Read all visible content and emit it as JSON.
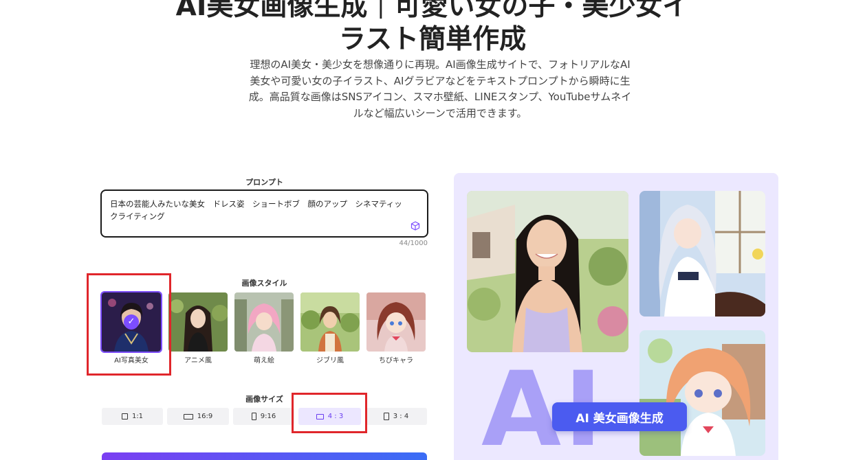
{
  "header": {
    "title_line1": "AI美女画像生成｜可愛い女の子・美少女イ",
    "title_line2": "ラスト簡単作成",
    "description": "理想のAI美女・美少女を想像通りに再現。AI画像生成サイトで、フォトリアルなAI美女や可愛い女の子イラスト、AIグラビアなどをテキストプロンプトから瞬時に生成。高品質な画像はSNSアイコン、スマホ壁紙、LINEスタンプ、YouTubeサムネイルなど幅広いシーンで活用できます。"
  },
  "prompt": {
    "label": "プロンプト",
    "value": "日本の芸能人みたいな美女　ドレス姿　ショートボブ　顔のアップ　シネマティックライティング",
    "counter": "44/1000",
    "icon": "cube-icon"
  },
  "styles": {
    "label": "画像スタイル",
    "items": [
      {
        "label": "AI写真美女",
        "selected": true
      },
      {
        "label": "アニメ風",
        "selected": false
      },
      {
        "label": "萌え絵",
        "selected": false
      },
      {
        "label": "ジブリ風",
        "selected": false
      },
      {
        "label": "ちびキャラ",
        "selected": false
      }
    ]
  },
  "sizes": {
    "label": "画像サイズ",
    "items": [
      {
        "label": "1:1",
        "active": false
      },
      {
        "label": "16:9",
        "active": false
      },
      {
        "label": "9:16",
        "active": false
      },
      {
        "label": "4 : 3",
        "active": true
      },
      {
        "label": "3 : 4",
        "active": false
      }
    ]
  },
  "showcase": {
    "big_text": "AI",
    "badge": "AI 美女画像生成"
  },
  "colors": {
    "accent": "#7c4dff",
    "highlight": "#e0262b",
    "showcase_bg": "#ece8ff",
    "badge_bg": "#4b5bf0"
  }
}
